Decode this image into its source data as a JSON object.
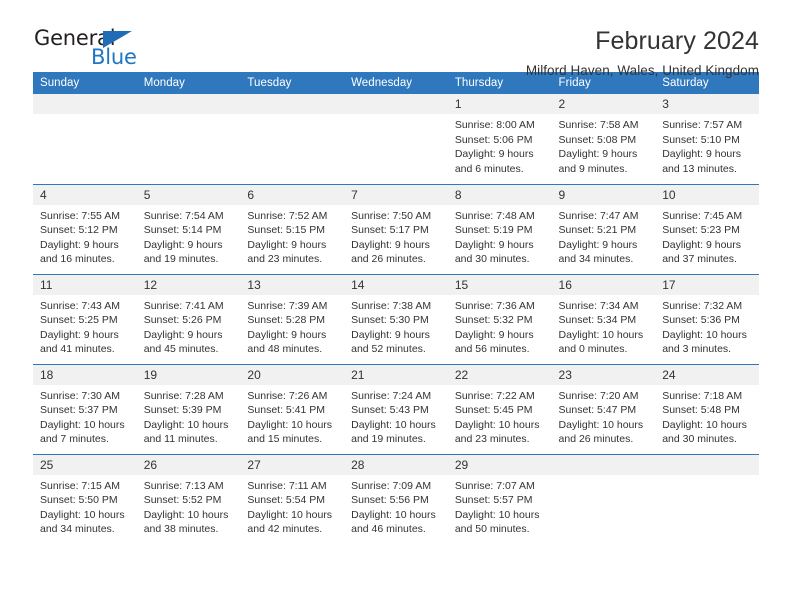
{
  "logo": {
    "text_top": "General",
    "text_bottom": "Blue",
    "flag_icon": "blue-triangle-flag-icon",
    "color_dark": "#231f20",
    "color_blue": "#1f76c4"
  },
  "header": {
    "title": "February 2024",
    "subtitle": "Milford Haven, Wales, United Kingdom"
  },
  "theme": {
    "header_blue": "#2f78bd",
    "daynum_gray": "#f1f1f1",
    "text": "#333333"
  },
  "calendar": {
    "weekday_headers": [
      "Sunday",
      "Monday",
      "Tuesday",
      "Wednesday",
      "Thursday",
      "Friday",
      "Saturday"
    ],
    "weeks": [
      [
        {
          "day": "",
          "lines": []
        },
        {
          "day": "",
          "lines": []
        },
        {
          "day": "",
          "lines": []
        },
        {
          "day": "",
          "lines": []
        },
        {
          "day": "1",
          "lines": [
            "Sunrise: 8:00 AM",
            "Sunset: 5:06 PM",
            "Daylight: 9 hours",
            "and 6 minutes."
          ]
        },
        {
          "day": "2",
          "lines": [
            "Sunrise: 7:58 AM",
            "Sunset: 5:08 PM",
            "Daylight: 9 hours",
            "and 9 minutes."
          ]
        },
        {
          "day": "3",
          "lines": [
            "Sunrise: 7:57 AM",
            "Sunset: 5:10 PM",
            "Daylight: 9 hours",
            "and 13 minutes."
          ]
        }
      ],
      [
        {
          "day": "4",
          "lines": [
            "Sunrise: 7:55 AM",
            "Sunset: 5:12 PM",
            "Daylight: 9 hours",
            "and 16 minutes."
          ]
        },
        {
          "day": "5",
          "lines": [
            "Sunrise: 7:54 AM",
            "Sunset: 5:14 PM",
            "Daylight: 9 hours",
            "and 19 minutes."
          ]
        },
        {
          "day": "6",
          "lines": [
            "Sunrise: 7:52 AM",
            "Sunset: 5:15 PM",
            "Daylight: 9 hours",
            "and 23 minutes."
          ]
        },
        {
          "day": "7",
          "lines": [
            "Sunrise: 7:50 AM",
            "Sunset: 5:17 PM",
            "Daylight: 9 hours",
            "and 26 minutes."
          ]
        },
        {
          "day": "8",
          "lines": [
            "Sunrise: 7:48 AM",
            "Sunset: 5:19 PM",
            "Daylight: 9 hours",
            "and 30 minutes."
          ]
        },
        {
          "day": "9",
          "lines": [
            "Sunrise: 7:47 AM",
            "Sunset: 5:21 PM",
            "Daylight: 9 hours",
            "and 34 minutes."
          ]
        },
        {
          "day": "10",
          "lines": [
            "Sunrise: 7:45 AM",
            "Sunset: 5:23 PM",
            "Daylight: 9 hours",
            "and 37 minutes."
          ]
        }
      ],
      [
        {
          "day": "11",
          "lines": [
            "Sunrise: 7:43 AM",
            "Sunset: 5:25 PM",
            "Daylight: 9 hours",
            "and 41 minutes."
          ]
        },
        {
          "day": "12",
          "lines": [
            "Sunrise: 7:41 AM",
            "Sunset: 5:26 PM",
            "Daylight: 9 hours",
            "and 45 minutes."
          ]
        },
        {
          "day": "13",
          "lines": [
            "Sunrise: 7:39 AM",
            "Sunset: 5:28 PM",
            "Daylight: 9 hours",
            "and 48 minutes."
          ]
        },
        {
          "day": "14",
          "lines": [
            "Sunrise: 7:38 AM",
            "Sunset: 5:30 PM",
            "Daylight: 9 hours",
            "and 52 minutes."
          ]
        },
        {
          "day": "15",
          "lines": [
            "Sunrise: 7:36 AM",
            "Sunset: 5:32 PM",
            "Daylight: 9 hours",
            "and 56 minutes."
          ]
        },
        {
          "day": "16",
          "lines": [
            "Sunrise: 7:34 AM",
            "Sunset: 5:34 PM",
            "Daylight: 10 hours",
            "and 0 minutes."
          ]
        },
        {
          "day": "17",
          "lines": [
            "Sunrise: 7:32 AM",
            "Sunset: 5:36 PM",
            "Daylight: 10 hours",
            "and 3 minutes."
          ]
        }
      ],
      [
        {
          "day": "18",
          "lines": [
            "Sunrise: 7:30 AM",
            "Sunset: 5:37 PM",
            "Daylight: 10 hours",
            "and 7 minutes."
          ]
        },
        {
          "day": "19",
          "lines": [
            "Sunrise: 7:28 AM",
            "Sunset: 5:39 PM",
            "Daylight: 10 hours",
            "and 11 minutes."
          ]
        },
        {
          "day": "20",
          "lines": [
            "Sunrise: 7:26 AM",
            "Sunset: 5:41 PM",
            "Daylight: 10 hours",
            "and 15 minutes."
          ]
        },
        {
          "day": "21",
          "lines": [
            "Sunrise: 7:24 AM",
            "Sunset: 5:43 PM",
            "Daylight: 10 hours",
            "and 19 minutes."
          ]
        },
        {
          "day": "22",
          "lines": [
            "Sunrise: 7:22 AM",
            "Sunset: 5:45 PM",
            "Daylight: 10 hours",
            "and 23 minutes."
          ]
        },
        {
          "day": "23",
          "lines": [
            "Sunrise: 7:20 AM",
            "Sunset: 5:47 PM",
            "Daylight: 10 hours",
            "and 26 minutes."
          ]
        },
        {
          "day": "24",
          "lines": [
            "Sunrise: 7:18 AM",
            "Sunset: 5:48 PM",
            "Daylight: 10 hours",
            "and 30 minutes."
          ]
        }
      ],
      [
        {
          "day": "25",
          "lines": [
            "Sunrise: 7:15 AM",
            "Sunset: 5:50 PM",
            "Daylight: 10 hours",
            "and 34 minutes."
          ]
        },
        {
          "day": "26",
          "lines": [
            "Sunrise: 7:13 AM",
            "Sunset: 5:52 PM",
            "Daylight: 10 hours",
            "and 38 minutes."
          ]
        },
        {
          "day": "27",
          "lines": [
            "Sunrise: 7:11 AM",
            "Sunset: 5:54 PM",
            "Daylight: 10 hours",
            "and 42 minutes."
          ]
        },
        {
          "day": "28",
          "lines": [
            "Sunrise: 7:09 AM",
            "Sunset: 5:56 PM",
            "Daylight: 10 hours",
            "and 46 minutes."
          ]
        },
        {
          "day": "29",
          "lines": [
            "Sunrise: 7:07 AM",
            "Sunset: 5:57 PM",
            "Daylight: 10 hours",
            "and 50 minutes."
          ]
        },
        {
          "day": "",
          "lines": []
        },
        {
          "day": "",
          "lines": []
        }
      ]
    ]
  }
}
